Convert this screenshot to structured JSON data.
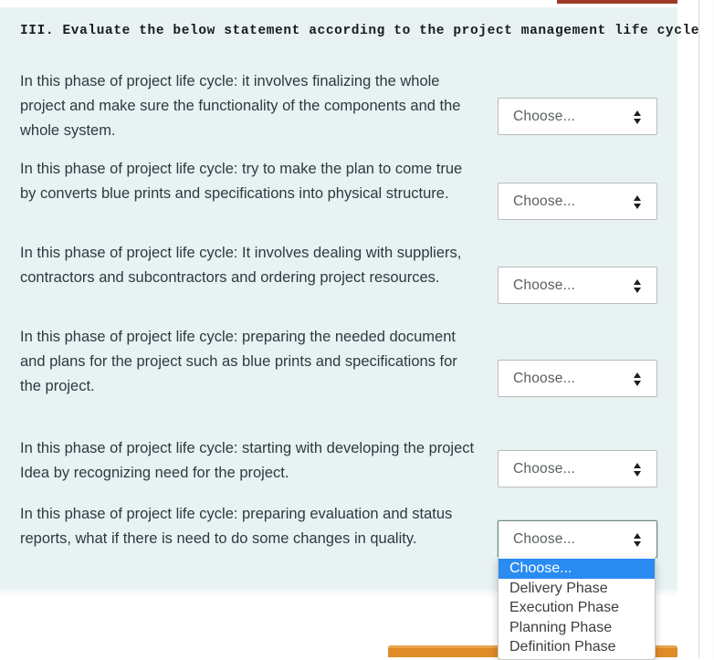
{
  "section": {
    "heading": "III. Evaluate the below statement according to the project management life cycle"
  },
  "select": {
    "placeholder": "Choose..."
  },
  "questions": [
    {
      "text": "In this phase of project life cycle: it involves finalizing the whole project and make sure the functionality of the components and the whole system.",
      "answer": "Choose..."
    },
    {
      "text": "In this phase of project life cycle: try to make the plan to come true by converts blue prints and specifications into physical structure.",
      "answer": "Choose..."
    },
    {
      "text": "In this phase of project life cycle: It involves dealing with suppliers, contractors and subcontractors and ordering project resources.",
      "answer": "Choose..."
    },
    {
      "text": "In this phase of project life cycle: preparing the needed document and plans for the project such as blue prints and specifications for the project.",
      "answer": "Choose..."
    },
    {
      "text": "In this phase of project life cycle: starting with developing the project Idea by recognizing need for the project.",
      "answer": "Choose..."
    },
    {
      "text": "In this phase of project life cycle: preparing evaluation and status reports, what if there is need to do some changes in quality.",
      "answer": "Choose..."
    }
  ],
  "dropdown": {
    "open": true,
    "options": [
      "Choose...",
      "Delivery Phase",
      "Execution Phase",
      "Planning Phase",
      "Definition Phase"
    ],
    "selected_index": 0
  },
  "colors": {
    "panel_background": "#e8f2f2",
    "text": "#2b3a42",
    "option_highlight": "#2a8bf0",
    "action_bar": "#df8c26",
    "top_strip": "#9c3a26"
  }
}
